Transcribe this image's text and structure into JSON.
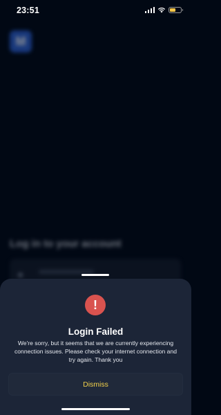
{
  "status_bar": {
    "time": "23:51",
    "battery_color": "#f5c64a",
    "icons": [
      "cellular-signal-icon",
      "wifi-icon",
      "battery-icon"
    ]
  },
  "background": {
    "logo_letter": "M",
    "heading": "Log in to your account"
  },
  "alert": {
    "icon": "exclamation-icon",
    "icon_symbol": "!",
    "icon_color": "#d9534f",
    "title": "Login Failed",
    "message": "We're sorry, but it seems that we are currently experiencing connection issues. Please check your internet connection and try again. Thank you",
    "dismiss_label": "Dismiss",
    "dismiss_color": "#f2d04b"
  }
}
